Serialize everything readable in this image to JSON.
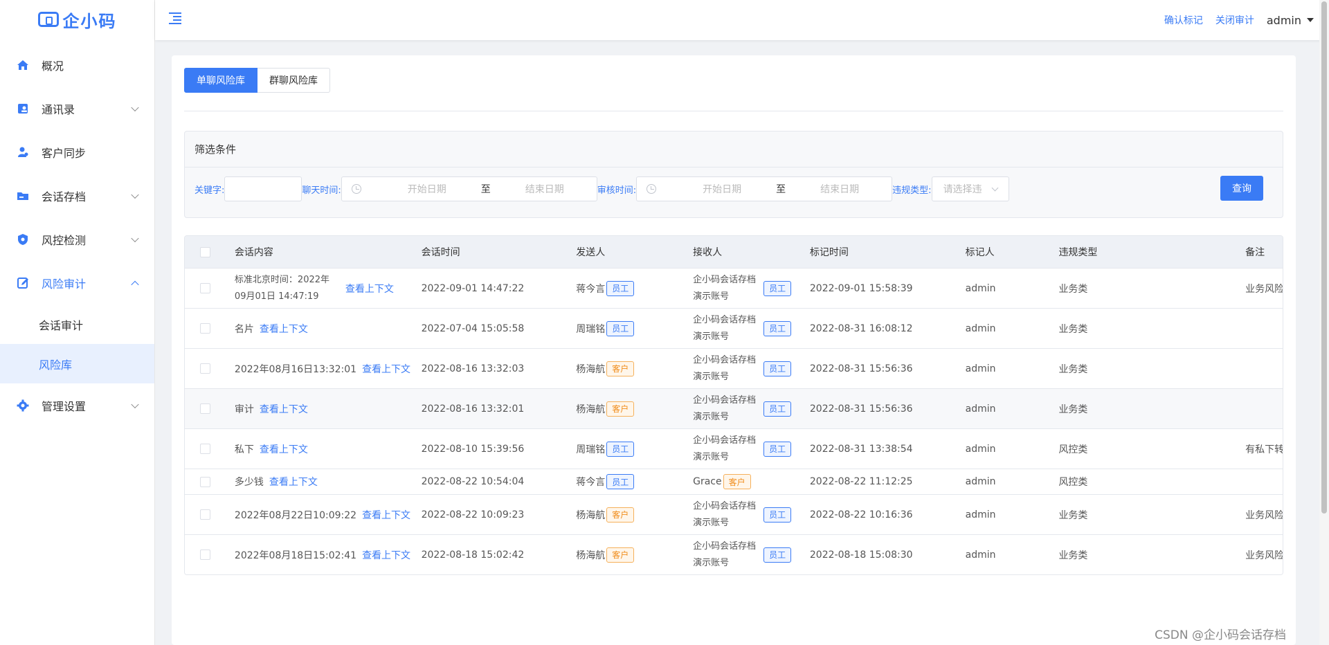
{
  "brand": {
    "name": "企小码"
  },
  "sidebar": {
    "items": [
      {
        "label": "概况",
        "icon": "home-icon",
        "has_children": false
      },
      {
        "label": "通讯录",
        "icon": "contacts-icon",
        "has_children": true
      },
      {
        "label": "客户同步",
        "icon": "user-sync-icon",
        "has_children": false
      },
      {
        "label": "会话存档",
        "icon": "folder-icon",
        "has_children": true
      },
      {
        "label": "风控检测",
        "icon": "shield-icon",
        "has_children": true
      },
      {
        "label": "风险审计",
        "icon": "edit-icon",
        "has_children": true,
        "expanded": true,
        "children": [
          {
            "label": "会话审计"
          },
          {
            "label": "风险库",
            "selected": true
          }
        ]
      },
      {
        "label": "管理设置",
        "icon": "gear-icon",
        "has_children": true
      }
    ]
  },
  "header": {
    "confirm_mark": "确认标记",
    "close_audit": "关闭审计",
    "user": "admin"
  },
  "tabs": [
    {
      "label": "单聊风险库",
      "active": true
    },
    {
      "label": "群聊风险库",
      "active": false
    }
  ],
  "filter": {
    "title": "筛选条件",
    "keyword_label": "关键字:",
    "chat_time_label": "聊天时间:",
    "audit_time_label": "审核时间:",
    "violation_label": "违规类型:",
    "start_placeholder": "开始日期",
    "range_sep": "至",
    "end_placeholder": "结束日期",
    "select_placeholder": "请选择违",
    "query_button": "查询"
  },
  "table": {
    "columns": [
      "会话内容",
      "会话时间",
      "发送人",
      "接收人",
      "标记时间",
      "标记人",
      "违规类型",
      "备注"
    ],
    "view_context": "查看上下文",
    "rows": [
      {
        "content": "标准北京时间：2022年09月01日 14:47:19",
        "time": "2022-09-01 14:47:22",
        "sender": "蒋今言",
        "sender_tag": "员工",
        "receiver": "企小码会话存档演示账号",
        "receiver_tag": "员工",
        "mark_time": "2022-09-01 15:58:39",
        "marker": "admin",
        "type": "业务类",
        "note": "业务风险"
      },
      {
        "content": "名片",
        "time": "2022-07-04 15:05:58",
        "sender": "周瑞铭",
        "sender_tag": "员工",
        "receiver": "企小码会话存档演示账号",
        "receiver_tag": "员工",
        "mark_time": "2022-08-31 16:08:12",
        "marker": "admin",
        "type": "业务类",
        "note": ""
      },
      {
        "content": "2022年08月16日13:32:01",
        "time": "2022-08-16 13:32:03",
        "sender": "杨海航",
        "sender_tag": "客户",
        "receiver": "企小码会话存档演示账号",
        "receiver_tag": "员工",
        "mark_time": "2022-08-31 15:56:36",
        "marker": "admin",
        "type": "业务类",
        "note": ""
      },
      {
        "content": "审计",
        "time": "2022-08-16 13:32:01",
        "sender": "杨海航",
        "sender_tag": "客户",
        "receiver": "企小码会话存档演示账号",
        "receiver_tag": "员工",
        "mark_time": "2022-08-31 15:56:36",
        "marker": "admin",
        "type": "业务类",
        "note": ""
      },
      {
        "content": "私下",
        "time": "2022-08-10 15:39:56",
        "sender": "周瑞铭",
        "sender_tag": "员工",
        "receiver": "企小码会话存档演示账号",
        "receiver_tag": "员工",
        "mark_time": "2022-08-31 13:38:54",
        "marker": "admin",
        "type": "风控类",
        "note": "有私下转账"
      },
      {
        "content": "多少钱",
        "time": "2022-08-22 10:54:04",
        "sender": "蒋今言",
        "sender_tag": "员工",
        "receiver": "Grace",
        "receiver_tag": "客户",
        "mark_time": "2022-08-22 11:12:25",
        "marker": "admin",
        "type": "风控类",
        "note": ""
      },
      {
        "content": "2022年08月22日10:09:22",
        "time": "2022-08-22 10:09:23",
        "sender": "杨海航",
        "sender_tag": "客户",
        "receiver": "企小码会话存档演示账号",
        "receiver_tag": "员工",
        "mark_time": "2022-08-22 10:16:36",
        "marker": "admin",
        "type": "业务类",
        "note": "业务风险"
      },
      {
        "content": "2022年08月18日15:02:41",
        "time": "2022-08-18 15:02:42",
        "sender": "杨海航",
        "sender_tag": "客户",
        "receiver": "企小码会话存档演示账号",
        "receiver_tag": "员工",
        "mark_time": "2022-08-18 15:08:30",
        "marker": "admin",
        "type": "业务类",
        "note": "业务风险"
      }
    ]
  },
  "watermark": "CSDN @企小码会话存档",
  "colors": {
    "accent": "#3a7bf5",
    "customer_tag": "#f08c1a"
  }
}
